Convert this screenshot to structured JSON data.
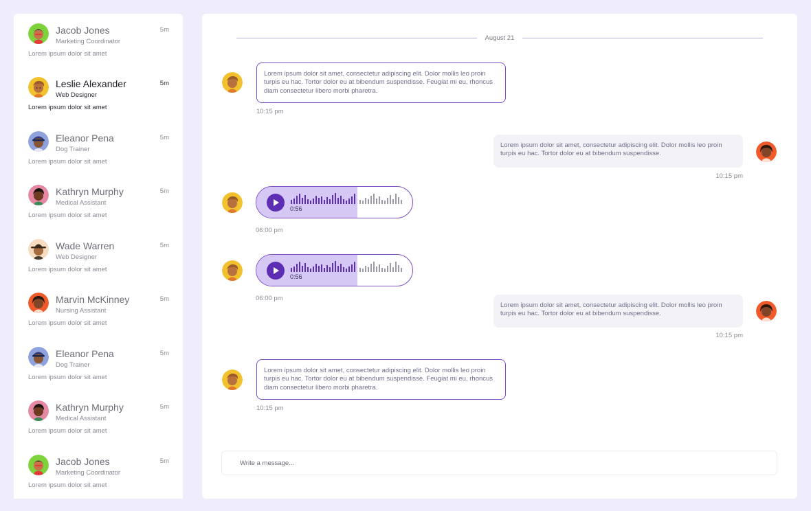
{
  "contacts": [
    {
      "name": "Jacob Jones",
      "role": "Marketing Coordinator",
      "time": "5m",
      "preview": "Lorem ipsum dolor sit amet",
      "avatar": "green"
    },
    {
      "name": "Leslie Alexander",
      "role": "Web Designer",
      "time": "5m",
      "preview": "Lorem ipsum dolor sit amet",
      "avatar": "yellow"
    },
    {
      "name": "Eleanor Pena",
      "role": "Dog Trainer",
      "time": "5m",
      "preview": "Lorem ipsum dolor sit amet",
      "avatar": "blue"
    },
    {
      "name": "Kathryn Murphy",
      "role": "Medical Assistant",
      "time": "5m",
      "preview": "Lorem ipsum dolor sit amet",
      "avatar": "pink"
    },
    {
      "name": "Wade Warren",
      "role": "Web Designer",
      "time": "5m",
      "preview": "Lorem ipsum dolor sit amet",
      "avatar": "peach"
    },
    {
      "name": "Marvin McKinney",
      "role": "Nursing Assistant",
      "time": "5m",
      "preview": "Lorem ipsum dolor sit amet",
      "avatar": "red"
    },
    {
      "name": "Eleanor Pena",
      "role": "Dog Trainer",
      "time": "5m",
      "preview": "Lorem ipsum dolor sit amet",
      "avatar": "blue"
    },
    {
      "name": "Kathryn Murphy",
      "role": "Medical Assistant",
      "time": "5m",
      "preview": "Lorem ipsum dolor sit amet",
      "avatar": "pink"
    },
    {
      "name": "Jacob Jones",
      "role": "Marketing Coordinator",
      "time": "5m",
      "preview": "Lorem ipsum dolor sit amet",
      "avatar": "green"
    }
  ],
  "active_contact_index": 1,
  "chat": {
    "date_divider": "August 21",
    "messages": [
      {
        "type": "text",
        "direction": "incoming",
        "text": "Lorem ipsum dolor sit amet, consectetur adipiscing elit. Dolor mollis leo proin turpis eu hac. Tortor dolor eu at bibendum suspendisse. Feugiat mi eu, rhoncus diam consectetur libero morbi pharetra.",
        "time": "10:15 pm"
      },
      {
        "type": "text",
        "direction": "outgoing",
        "text": "Lorem ipsum dolor sit amet, consectetur adipiscing elit. Dolor mollis leo proin turpis eu hac. Tortor dolor eu at bibendum suspendisse.",
        "time": "10:15 pm"
      },
      {
        "type": "voice",
        "direction": "incoming",
        "duration": "0:56",
        "progress": 0.64,
        "time": "06:00 pm"
      },
      {
        "type": "voice",
        "direction": "incoming",
        "duration": "0:56",
        "progress": 0.64,
        "time": "06:00 pm"
      },
      {
        "type": "text",
        "direction": "outgoing",
        "text": "Lorem ipsum dolor sit amet, consectetur adipiscing elit. Dolor mollis leo proin turpis eu hac. Tortor dolor eu at bibendum suspendisse.",
        "time": "10:15 pm"
      },
      {
        "type": "text",
        "direction": "incoming",
        "text": "Lorem ipsum dolor sit amet, consectetur adipiscing elit. Dolor mollis leo proin turpis eu hac. Tortor dolor eu at bibendum suspendisse. Feugiat mi eu, rhoncus diam consectetur libero morbi pharetra.",
        "time": "10:15 pm"
      }
    ]
  },
  "composer": {
    "placeholder": "Write a message..."
  },
  "colors": {
    "accent": "#5d2eb4",
    "bubble_border": "#7b4fc9",
    "voice_fill": "#d6c8f5",
    "background": "#efedfb"
  },
  "icons": {
    "play": "play-icon"
  }
}
